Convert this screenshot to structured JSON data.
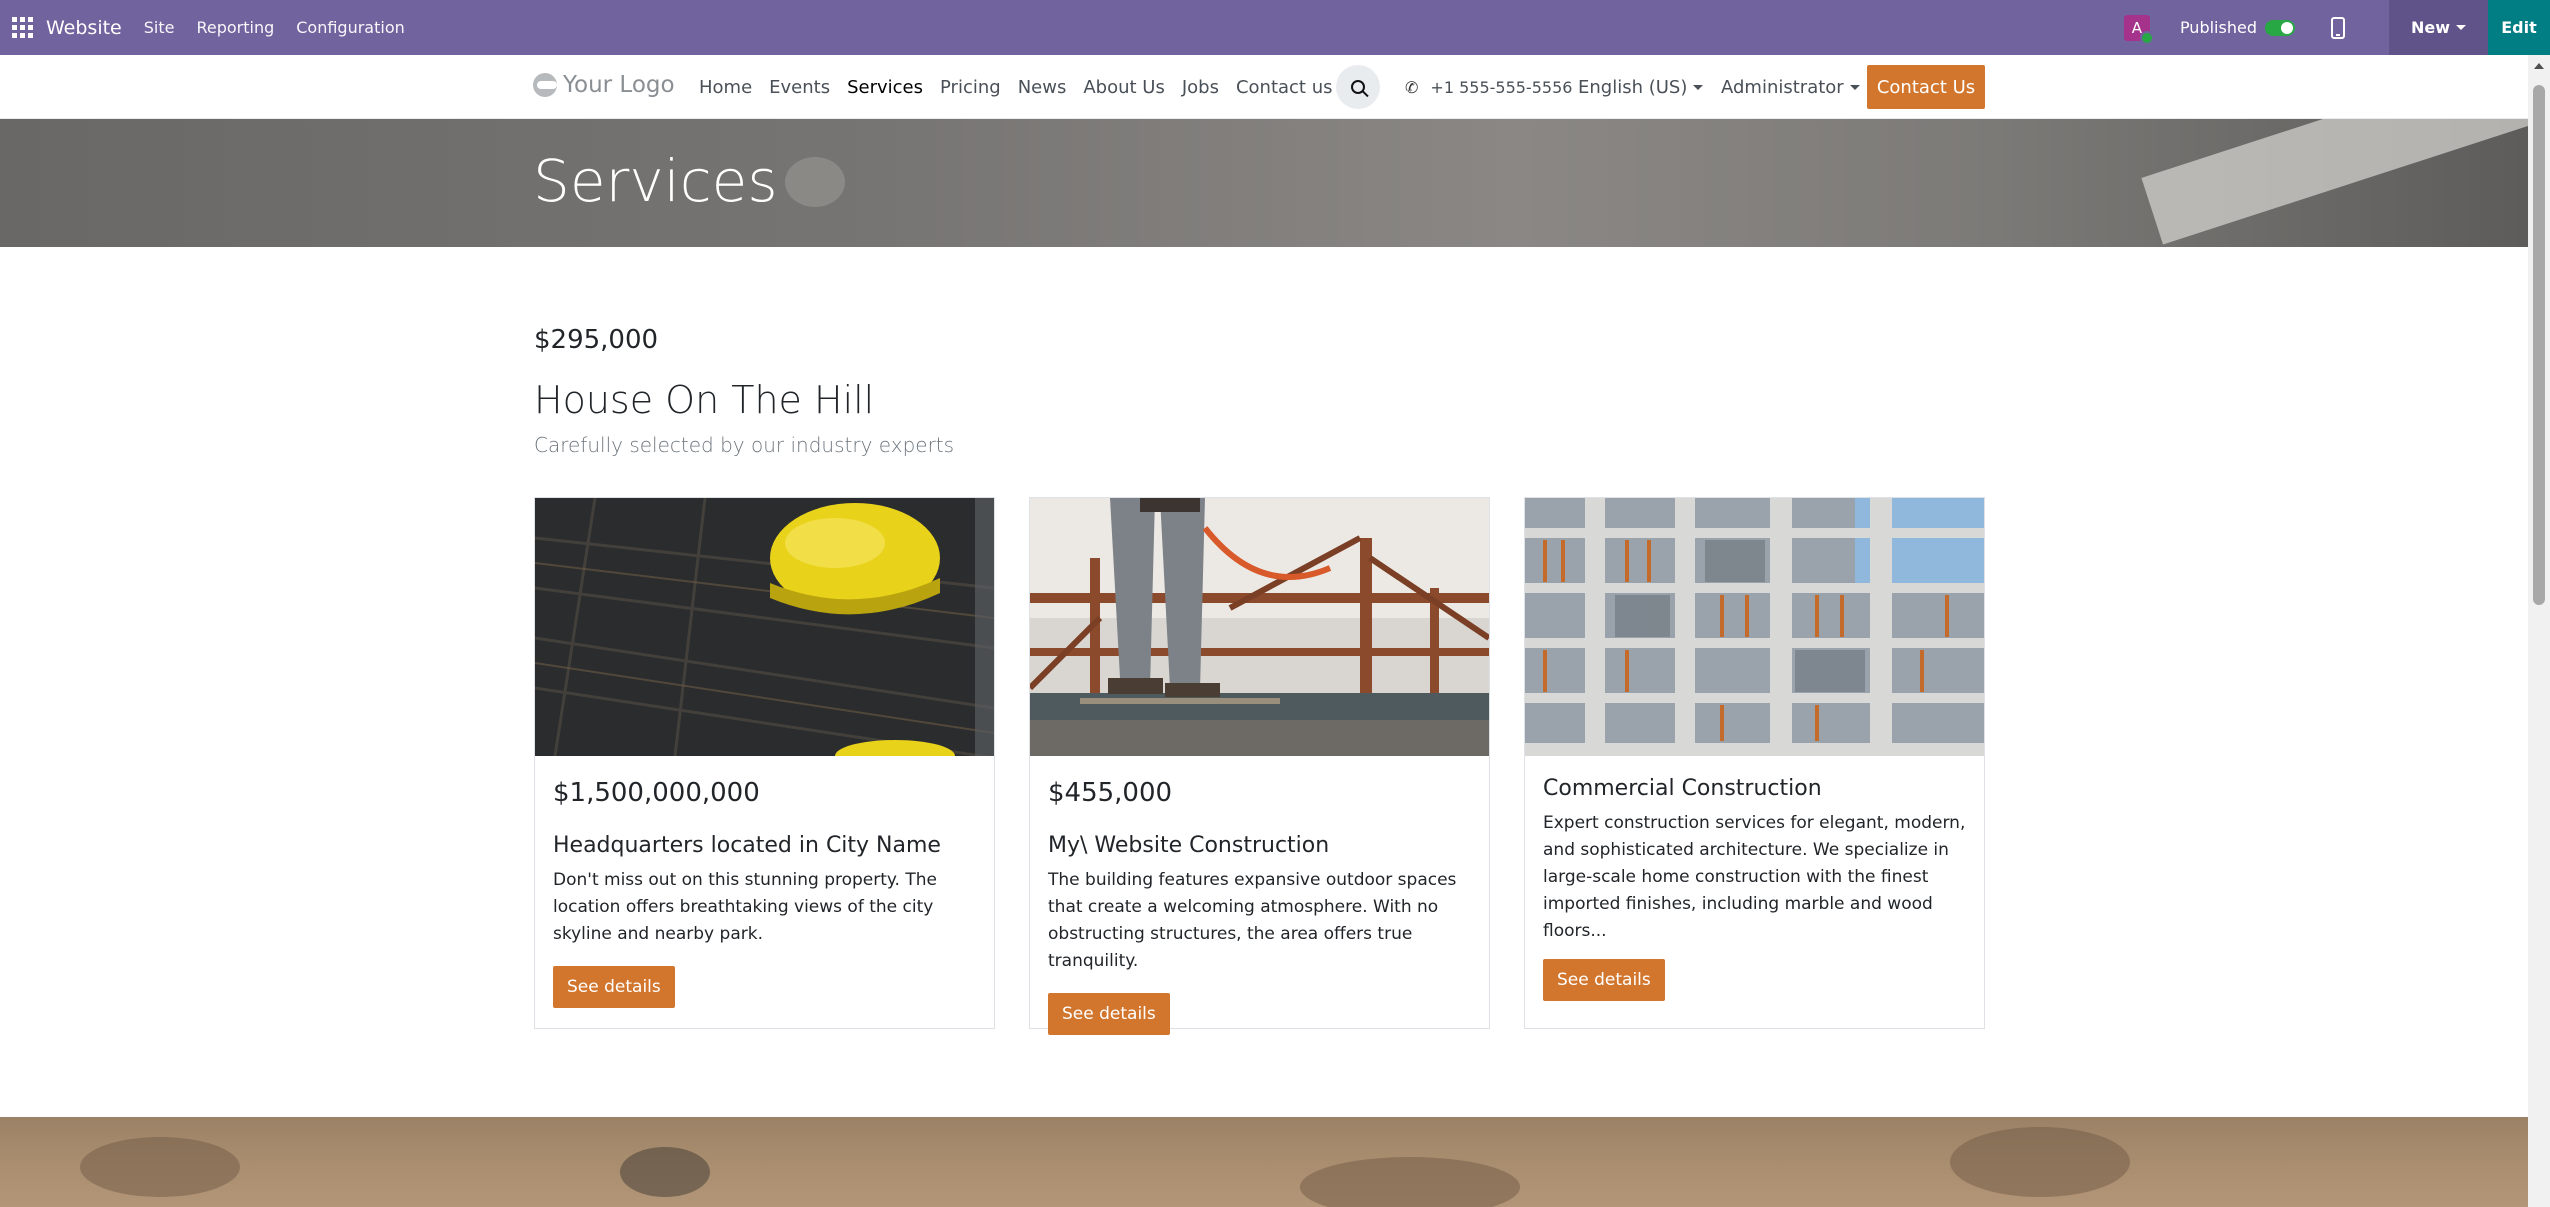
{
  "adminbar": {
    "brand": "Website",
    "menus": [
      "Site",
      "Reporting",
      "Configuration"
    ],
    "avatar_letter": "A",
    "published_label": "Published",
    "new_label": "New",
    "edit_label": "Edit"
  },
  "nav": {
    "logo_text": "Your Logo",
    "links": [
      "Home",
      "Events",
      "Services",
      "Pricing",
      "News",
      "About Us",
      "Jobs",
      "Contact us"
    ],
    "active": "Services",
    "phone": "+1 555-555-5556",
    "language": "English (US)",
    "user": "Administrator",
    "contact_button": "Contact Us"
  },
  "hero": {
    "title": "Services"
  },
  "section": {
    "price": "$295,000",
    "title": "House On The Hill",
    "subtitle": "Carefully selected by our industry experts"
  },
  "cards": [
    {
      "price": "$1,500,000,000",
      "title": "Headquarters located in City Name",
      "text": "Don't miss out on this stunning property. The location offers breathtaking views of the city skyline and nearby park.",
      "button": "See details"
    },
    {
      "price": "$455,000",
      "title": "My\\ Website Construction",
      "text": "The building features expansive outdoor spaces that create a welcoming atmosphere. With no obstructing structures, the area offers true tranquility.",
      "button": "See details"
    },
    {
      "price": "",
      "title": "Commercial Construction",
      "text": "Expert construction services for elegant, modern, and sophisticated architecture. We specialize in large-scale home construction with the finest imported finishes, including marble and wood floors...",
      "button": "See details"
    }
  ],
  "colors": {
    "admin_bar": "#71639e",
    "edit": "#017e84",
    "accent": "#d2762d"
  }
}
